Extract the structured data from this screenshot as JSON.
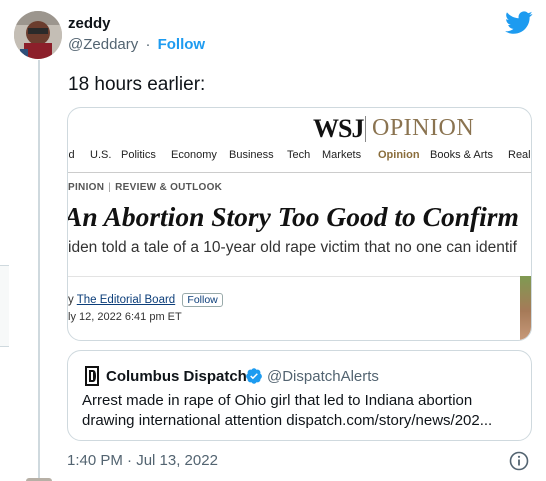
{
  "tweet": {
    "author_name": "zeddy",
    "author_handle": "@Zeddary",
    "separator": "·",
    "follow_label": "Follow",
    "text": "18 hours earlier:",
    "timestamp": "1:40 PM · Jul 13, 2022",
    "brand_icon": "twitter-bird-icon",
    "brand_color": "#1d9bf0"
  },
  "card": {
    "logo": "WSJ",
    "logo_section": "OPINION",
    "nav": [
      "ld",
      "U.S.",
      "Politics",
      "Economy",
      "Business",
      "Tech",
      "Markets",
      "Opinion",
      "Books & Arts",
      "Real"
    ],
    "active_nav": "Opinion",
    "section_left": "PINION",
    "section_right": "REVIEW & OUTLOOK",
    "headline": "An Abortion Story Too Good to Confirm",
    "dek": "iden told a tale of a 10-year old rape victim that no one can identif",
    "byline_prefix": "y",
    "author": "The Editorial Board",
    "follow_label": "Follow",
    "date": "ly 12, 2022 6:41 pm ET"
  },
  "quote": {
    "name": "Columbus Dispatch",
    "handle": "@DispatchAlerts",
    "text": "Arrest made in rape of Ohio girl that led to Indiana abortion drawing international attention dispatch.com/story/news/202..."
  }
}
